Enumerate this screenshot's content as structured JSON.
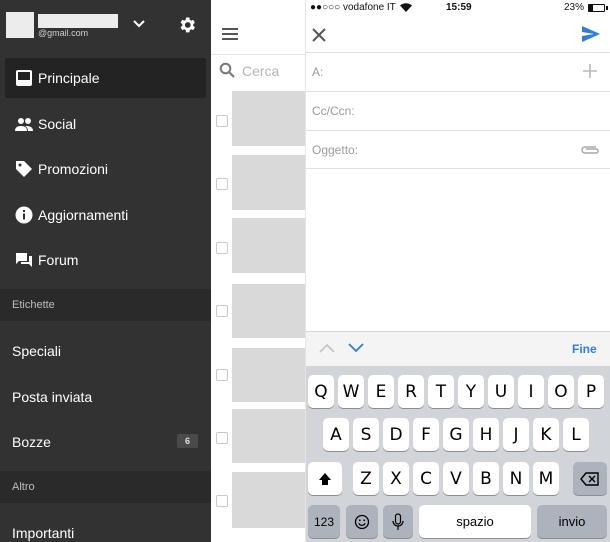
{
  "drawer": {
    "account_email": "@gmail.com",
    "items": [
      {
        "label": "Principale",
        "icon": "inbox-icon"
      },
      {
        "label": "Social",
        "icon": "people-icon"
      },
      {
        "label": "Promozioni",
        "icon": "tag-icon"
      },
      {
        "label": "Aggiornamenti",
        "icon": "info-icon"
      },
      {
        "label": "Forum",
        "icon": "forum-icon"
      }
    ],
    "section_labels": "Etichette",
    "labels": [
      {
        "label": "Speciali"
      },
      {
        "label": "Posta inviata"
      },
      {
        "label": "Bozze",
        "count": "6"
      }
    ],
    "section_other": "Altro",
    "other": [
      {
        "label": "Importanti"
      }
    ]
  },
  "inbox": {
    "search_placeholder": "Cerca"
  },
  "compose": {
    "status": {
      "carrier": "●●○○○ vodafone IT",
      "time": "15:59",
      "battery": "23%"
    },
    "to_label": "A:",
    "cc_label": "Cc/Ccn:",
    "subject_label": "Oggetto:"
  },
  "keyboard": {
    "done": "Fine",
    "row1": [
      "Q",
      "W",
      "E",
      "R",
      "T",
      "Y",
      "U",
      "I",
      "O",
      "P"
    ],
    "row2": [
      "A",
      "S",
      "D",
      "F",
      "G",
      "H",
      "J",
      "K",
      "L"
    ],
    "row3": [
      "Z",
      "X",
      "C",
      "V",
      "B",
      "N",
      "M"
    ],
    "numbers": "123",
    "space": "spazio",
    "return": "invio"
  },
  "colors": {
    "drawer_bg": "#323232",
    "accent_blue": "#2f7de1"
  }
}
